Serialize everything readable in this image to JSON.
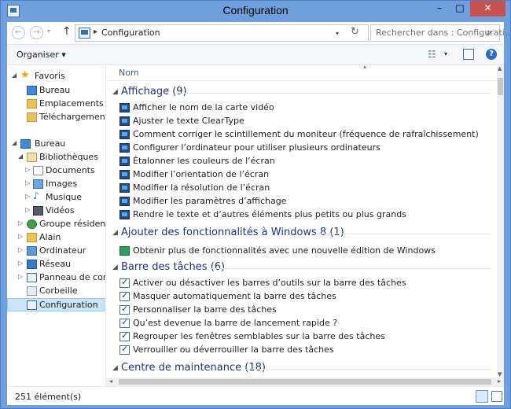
{
  "window": {
    "title": "Configuration"
  },
  "title_buttons": {
    "minimize": "–",
    "maximize": "□",
    "close": "✕"
  },
  "nav_buttons": {
    "back": "←",
    "forward": "→",
    "recent": "▾",
    "up": "↑"
  },
  "address": {
    "separator": "▸",
    "path": "Configuration",
    "dropdown": "▾",
    "refresh": "↻"
  },
  "search": {
    "placeholder": "Rechercher dans : Configurati...",
    "icon_glyph": "⌕"
  },
  "toolbar": {
    "organize": "Organiser ▾",
    "view_glyph": "☷",
    "view_dropdown": "▾",
    "help": "?"
  },
  "sidebar": {
    "favorites": {
      "label": "Favoris",
      "items": [
        "Bureau",
        "Emplacements récents",
        "Téléchargements"
      ]
    },
    "desktop": {
      "label": "Bureau",
      "libraries": {
        "label": "Bibliothèques",
        "items": [
          "Documents",
          "Images",
          "Musique",
          "Vidéos"
        ]
      },
      "items": [
        "Groupe résidentiel",
        "Alain",
        "Ordinateur",
        "Réseau",
        "Panneau de configuration",
        "Corbeille",
        "Configuration"
      ]
    }
  },
  "columns": {
    "name": "Nom",
    "sort_glyph": "▴"
  },
  "groups": [
    {
      "title": "Affichage (9)",
      "icon": "monitor-icon",
      "items": [
        "Afficher le nom de la carte vidéo",
        "Ajuster le texte ClearType",
        "Comment corriger le scintillement du moniteur (fréquence de rafraîchissement)",
        "Configurer l’ordinateur pour utiliser plusieurs ordinateurs",
        "Étalonner les couleurs de l’écran",
        "Modifier l’orientation de l’écran",
        "Modifier la résolution de l’écran",
        "Modifier les paramètres d’affichage",
        "Rendre le texte et d’autres éléments plus petits ou plus grands"
      ]
    },
    {
      "title": "Ajouter des fonctionnalités à Windows 8 (1)",
      "icon": "windows-feature-icon",
      "items": [
        "Obtenir plus de fonctionnalités avec une nouvelle édition de Windows"
      ]
    },
    {
      "title": "Barre des tâches (6)",
      "icon": "taskbar-checkbox-icon",
      "items": [
        "Activer ou désactiver les barres d’outils sur la barre des tâches",
        "Masquer automatiquement la barre des tâches",
        "Personnaliser la barre des tâches",
        "Qu’est devenue la barre de lancement rapide ?",
        "Regrouper les fenêtres semblables sur la barre des tâches",
        "Verrouiller ou déverrouiller la barre des tâches"
      ]
    },
    {
      "title": "Centre de maintenance (18)",
      "icon": "maintenance-icon",
      "items": []
    }
  ],
  "scroll_glyphs": {
    "up": "▲",
    "down": "▼",
    "left": "◂",
    "right": "▸"
  },
  "expand_glyphs": {
    "open": "◢",
    "closed": "▷"
  },
  "status": {
    "count": "251 élément(s)"
  },
  "colors": {
    "frame": "#6fa0dd",
    "group_title": "#1e3287",
    "selected": "#cce4f7"
  }
}
